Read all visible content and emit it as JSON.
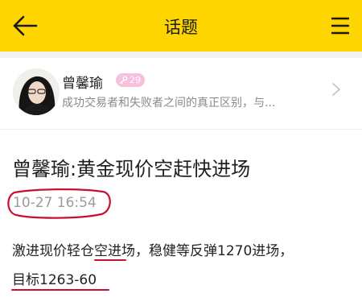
{
  "header": {
    "title": "话题",
    "back_icon": "arrow-left-icon",
    "menu_icon": "hamburger-menu-icon",
    "background": "#ffd500"
  },
  "author": {
    "name": "曾馨瑜",
    "badge_count": "29",
    "badge_icon": "key-icon",
    "intro": "成功交易者和失败者之间的真正区别，与..."
  },
  "post": {
    "headline": "曾馨瑜:黄金现价空赶快进场",
    "timestamp": "10-27 16:54",
    "body_line1_a": "激进现价轻仓",
    "body_line1_b": "空",
    "body_line1_c": "进场，稳健等反弹1270进场，",
    "body_line2": "目标1263-60"
  },
  "annotations": {
    "color": "#c8102e"
  }
}
